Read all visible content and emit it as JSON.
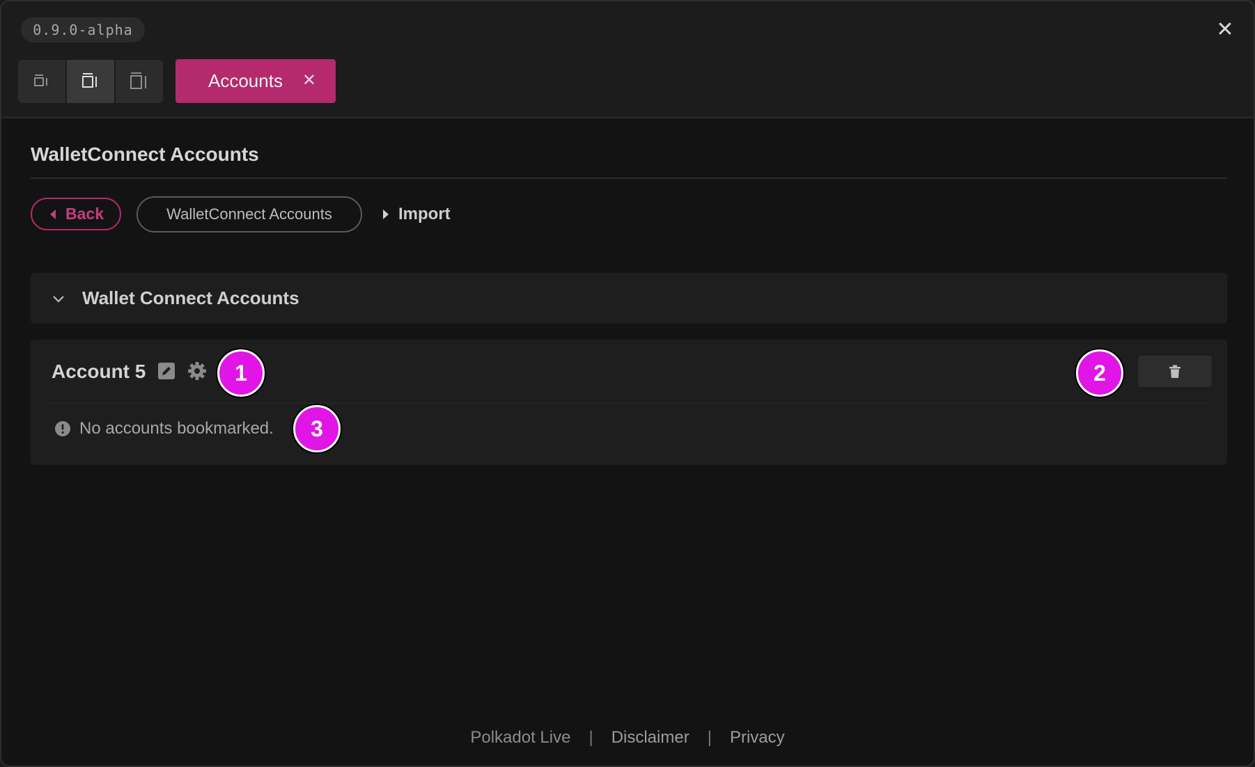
{
  "header": {
    "version": "0.9.0-alpha",
    "close_label": "✕",
    "layout_buttons": [
      {
        "icon": "layout-small-icon"
      },
      {
        "icon": "layout-medium-icon"
      },
      {
        "icon": "layout-large-icon"
      }
    ],
    "tab": {
      "label": "Accounts",
      "close_label": "✕"
    }
  },
  "page": {
    "title": "WalletConnect Accounts",
    "breadcrumb": {
      "back_label": "Back",
      "current_label": "WalletConnect Accounts",
      "next_label": "Import"
    }
  },
  "section": {
    "title": "Wallet Connect Accounts"
  },
  "account": {
    "name": "Account 5",
    "empty_message": "No accounts bookmarked."
  },
  "markers": [
    "1",
    "2",
    "3"
  ],
  "footer": {
    "brand": "Polkadot Live",
    "separator": "|",
    "disclaimer": "Disclaimer",
    "privacy": "Privacy"
  },
  "colors": {
    "accent": "#b42a6c",
    "marker": "#e015e6",
    "background": "#131313"
  }
}
